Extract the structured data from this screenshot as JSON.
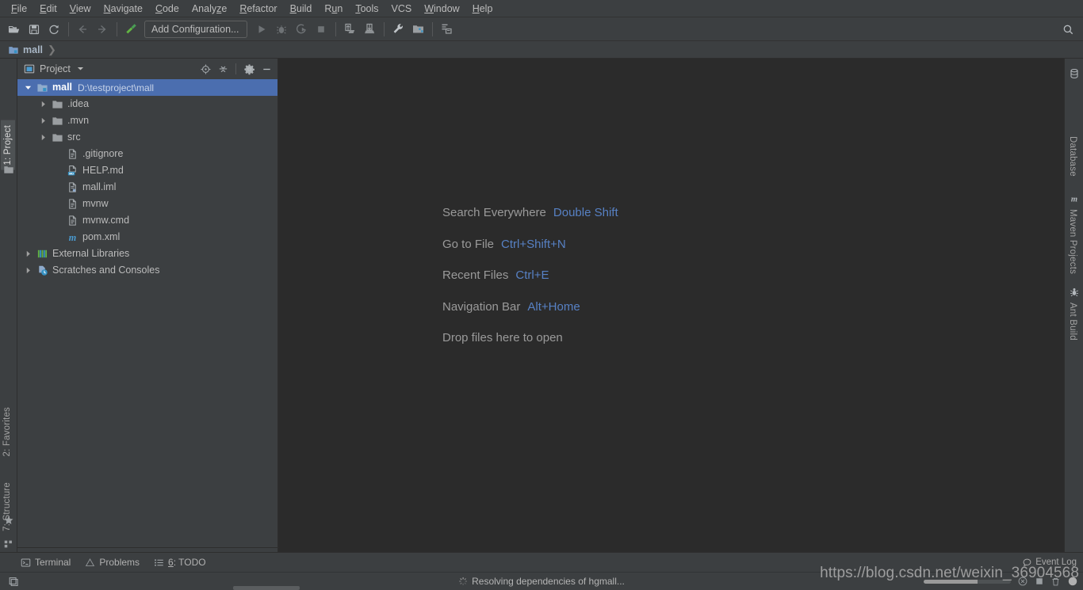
{
  "menubar": {
    "items": [
      {
        "label": "File",
        "mnemonic": "F"
      },
      {
        "label": "Edit",
        "mnemonic": "E"
      },
      {
        "label": "View",
        "mnemonic": "V"
      },
      {
        "label": "Navigate",
        "mnemonic": "N"
      },
      {
        "label": "Code",
        "mnemonic": "C"
      },
      {
        "label": "Analyze",
        "mnemonic": "z"
      },
      {
        "label": "Refactor",
        "mnemonic": "R"
      },
      {
        "label": "Build",
        "mnemonic": "B"
      },
      {
        "label": "Run",
        "mnemonic": "u"
      },
      {
        "label": "Tools",
        "mnemonic": "T"
      },
      {
        "label": "VCS",
        "mnemonic": ""
      },
      {
        "label": "Window",
        "mnemonic": "W"
      },
      {
        "label": "Help",
        "mnemonic": "H"
      }
    ]
  },
  "toolbar": {
    "run_configuration": "Add Configuration...",
    "icons": [
      "open-project-icon",
      "save-all-icon",
      "sync-refresh-icon",
      "navigate-back-icon",
      "navigate-forward-icon",
      "build-hammer-icon",
      "run-icon",
      "debug-icon",
      "run-with-coverage-icon",
      "stop-icon",
      "update-project-icon",
      "commit-icon",
      "settings-wrench-icon",
      "project-structure-icon",
      "search-structure-icon"
    ],
    "search_icon": "search-icon"
  },
  "breadcrumb": {
    "root": "mall",
    "separator": "❯"
  },
  "left_stripe": {
    "top_tabs": [
      {
        "label": "1: Project",
        "number": "1",
        "name": "Project",
        "active": true
      }
    ],
    "bottom_tabs": [
      {
        "label": "2: Favorites",
        "number": "2",
        "name": "Favorites",
        "icon": "star-icon"
      },
      {
        "label": "7: Structure",
        "number": "7",
        "name": "Structure",
        "icon": "structure-icon"
      }
    ]
  },
  "right_stripe": {
    "tabs": [
      {
        "label": "Database",
        "icon": "database-icon"
      },
      {
        "label": "Maven Projects",
        "icon": "maven-icon"
      },
      {
        "label": "Ant Build",
        "icon": "ant-icon"
      }
    ]
  },
  "project_panel": {
    "title": "Project",
    "title_icon": "project-view-icon",
    "dropdown_icon": "chevron-down-icon",
    "actions": [
      {
        "name": "locate-file-icon",
        "title": "Select Opened File"
      },
      {
        "name": "collapse-all-icon",
        "title": "Collapse All"
      },
      {
        "name": "gear-icon",
        "title": "Settings"
      },
      {
        "name": "minimize-icon",
        "title": "Hide"
      }
    ],
    "tree": [
      {
        "label": "mall",
        "path": "D:\\testproject\\mall",
        "indent": 0,
        "arrow": "expanded",
        "icon": "module-folder-icon",
        "selected": true,
        "bold": true
      },
      {
        "label": ".idea",
        "path": "",
        "indent": 1,
        "arrow": "collapsed",
        "icon": "folder-icon",
        "selected": false,
        "bold": false
      },
      {
        "label": ".mvn",
        "path": "",
        "indent": 1,
        "arrow": "collapsed",
        "icon": "folder-icon",
        "selected": false,
        "bold": false
      },
      {
        "label": "src",
        "path": "",
        "indent": 1,
        "arrow": "collapsed",
        "icon": "folder-icon",
        "selected": false,
        "bold": false
      },
      {
        "label": ".gitignore",
        "path": "",
        "indent": 2,
        "arrow": "none",
        "icon": "file-text-icon",
        "selected": false,
        "bold": false
      },
      {
        "label": "HELP.md",
        "path": "",
        "indent": 2,
        "arrow": "none",
        "icon": "markdown-file-icon",
        "selected": false,
        "bold": false
      },
      {
        "label": "mall.iml",
        "path": "",
        "indent": 2,
        "arrow": "none",
        "icon": "iml-file-icon",
        "selected": false,
        "bold": false
      },
      {
        "label": "mvnw",
        "path": "",
        "indent": 2,
        "arrow": "none",
        "icon": "file-text-icon",
        "selected": false,
        "bold": false
      },
      {
        "label": "mvnw.cmd",
        "path": "",
        "indent": 2,
        "arrow": "none",
        "icon": "file-text-icon",
        "selected": false,
        "bold": false
      },
      {
        "label": "pom.xml",
        "path": "",
        "indent": 2,
        "arrow": "none",
        "icon": "maven-pom-icon",
        "selected": false,
        "bold": false
      },
      {
        "label": "External Libraries",
        "path": "",
        "indent": 0,
        "arrow": "collapsed",
        "icon": "libraries-icon",
        "selected": false,
        "bold": false
      },
      {
        "label": "Scratches and Consoles",
        "path": "",
        "indent": 0,
        "arrow": "collapsed",
        "icon": "scratches-icon",
        "selected": false,
        "bold": false
      }
    ]
  },
  "editor": {
    "tips": [
      {
        "action": "Search Everywhere",
        "shortcut": "Double Shift"
      },
      {
        "action": "Go to File",
        "shortcut": "Ctrl+Shift+N"
      },
      {
        "action": "Recent Files",
        "shortcut": "Ctrl+E"
      },
      {
        "action": "Navigation Bar",
        "shortcut": "Alt+Home"
      },
      {
        "action": "Drop files here to open",
        "shortcut": ""
      }
    ]
  },
  "bottom_bar": {
    "items": [
      {
        "label": "Terminal",
        "icon": "terminal-icon"
      },
      {
        "label": "Problems",
        "icon": "warning-triangle-icon"
      },
      {
        "label": "6: TODO",
        "icon": "todo-list-icon",
        "number": "6"
      }
    ],
    "event_log": {
      "label": "Event Log",
      "icon": "balloon-icon"
    }
  },
  "status_bar": {
    "left_icon": "toggle-toolwindows-icon",
    "progress_text": "Resolving dependencies of hgmall...",
    "spinner_icon": "spinner-icon",
    "progress_percent": 62
  },
  "watermark": "https://blog.csdn.net/weixin_36904568",
  "colors": {
    "window_bg": "#3c3f41",
    "editor_bg": "#2b2b2b",
    "selection_blue": "#4b6eaf",
    "shortcut_blue": "#5781c4",
    "text": "#bbbbbb",
    "muted_text": "#9a9a9a",
    "folder_blue": "#7a9cc6"
  }
}
